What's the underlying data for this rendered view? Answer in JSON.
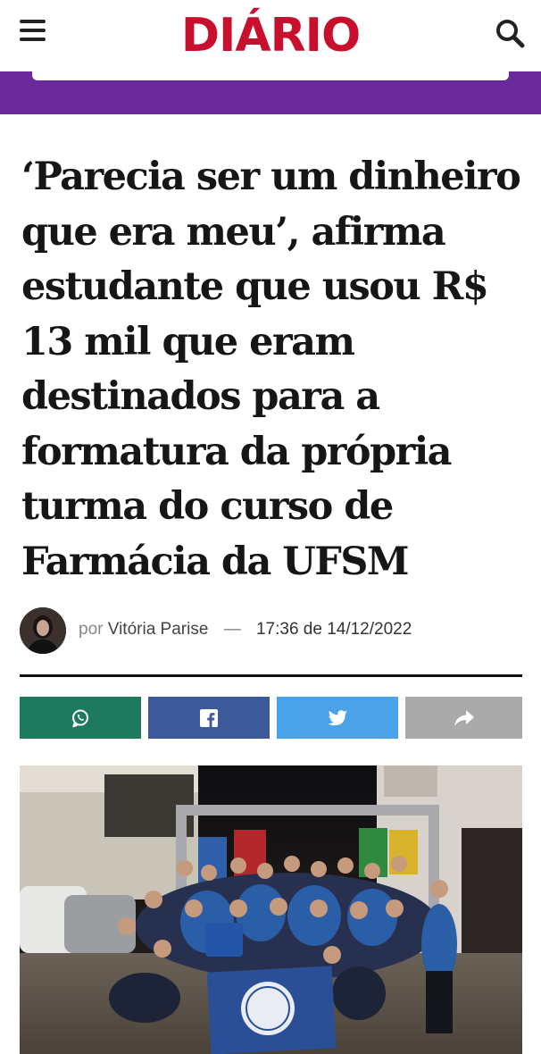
{
  "header": {
    "logo_text": "DIÁRIO",
    "logo_color": "#c8102e",
    "menu_icon": "hamburger-menu-icon",
    "search_icon": "search-icon"
  },
  "promo_bar": {
    "color": "#6a2a9c"
  },
  "article": {
    "headline": "‘Parecia ser um dinheiro que era meu’, afirma estudante que usou R$ 13 mil que eram destinados para a formatura da própria turma do curso de Farmácia da UFSM",
    "byline": {
      "prefix": "por",
      "author": "Vitória Parise",
      "separator": "—",
      "datetime": "17:36 de 14/12/2022"
    }
  },
  "share_buttons": [
    {
      "name": "whatsapp",
      "icon": "whatsapp-icon",
      "color": "#1e7a5e"
    },
    {
      "name": "facebook",
      "icon": "facebook-icon",
      "color": "#3c5a99"
    },
    {
      "name": "twitter",
      "icon": "twitter-icon",
      "color": "#4aa3e8"
    },
    {
      "name": "share",
      "icon": "share-arrow-icon",
      "color": "#aaaaaa"
    }
  ]
}
